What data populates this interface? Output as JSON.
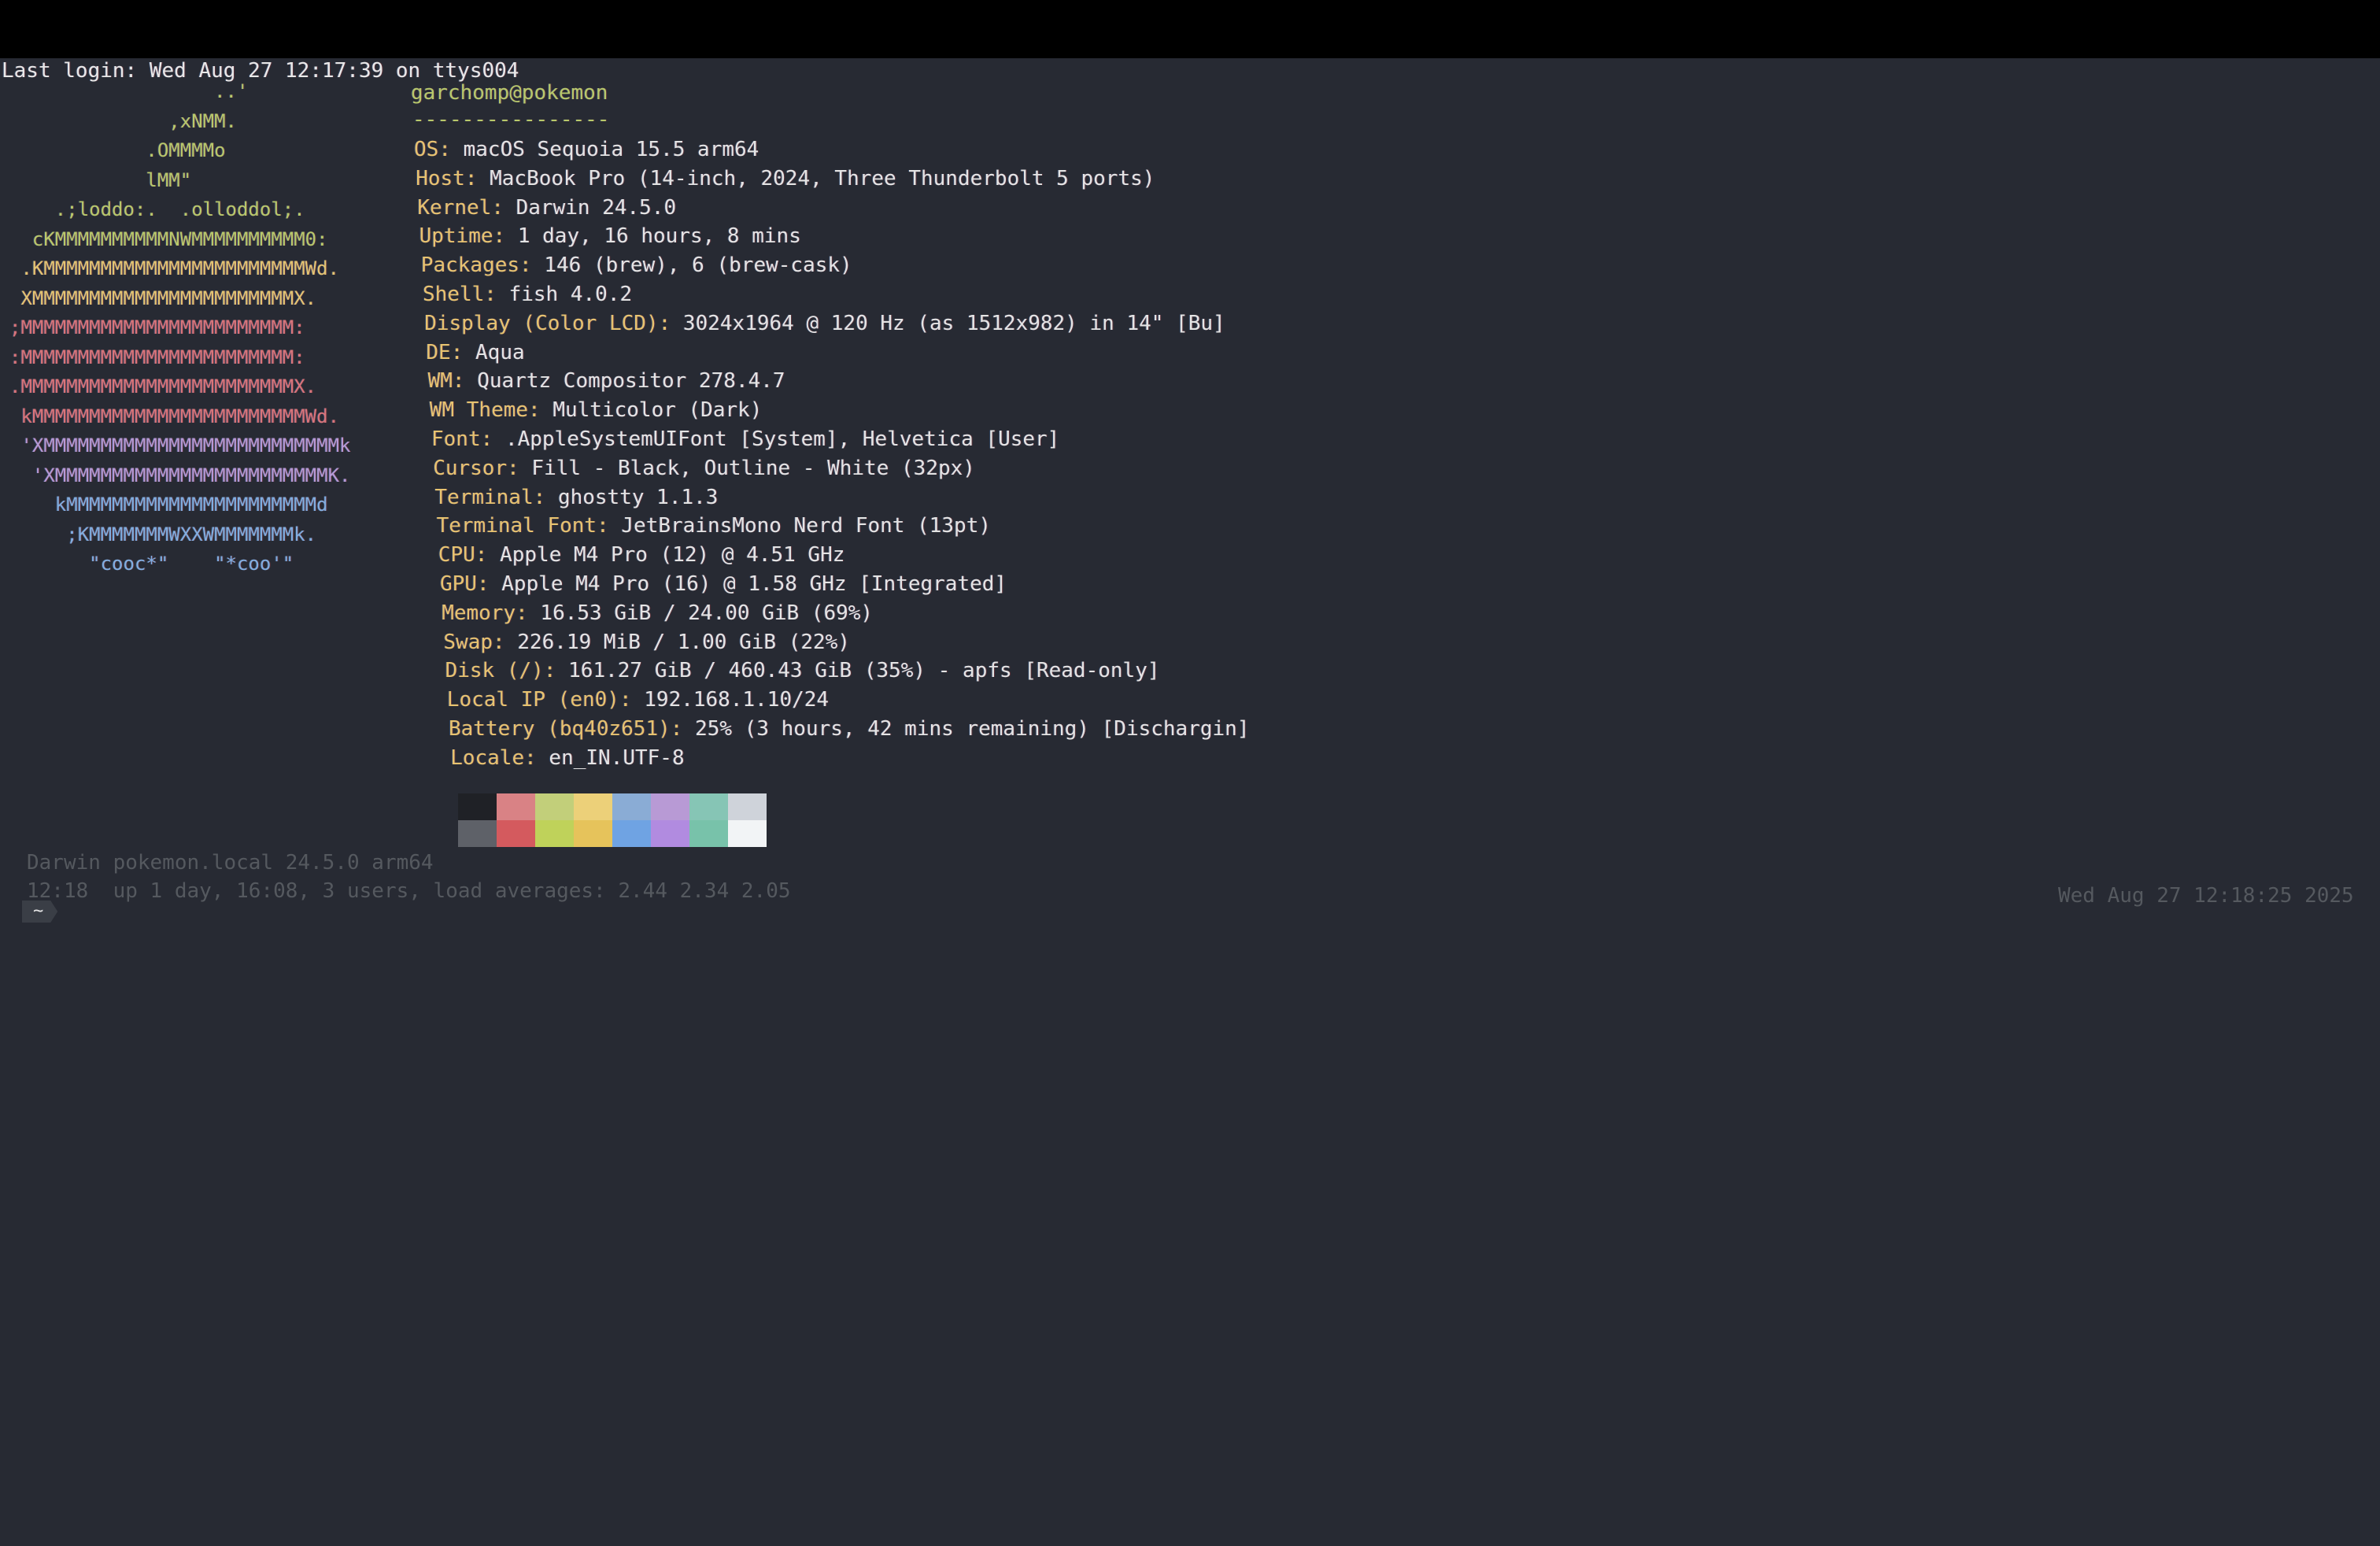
{
  "login_line": "Last login: Wed Aug 27 12:17:39 on ttys004",
  "logo": {
    "rows": [
      {
        "text": "                  ..'",
        "color": "green"
      },
      {
        "text": "              ,xNMM.",
        "color": "green"
      },
      {
        "text": "            .OMMMMo",
        "color": "green"
      },
      {
        "text": "            lMM\"",
        "color": "green"
      },
      {
        "text": "    .;loddo:.  .olloddol;.",
        "color": "green"
      },
      {
        "text": "  cKMMMMMMMMMMNWMMMMMMMMMM0:",
        "color": "green"
      },
      {
        "text": " .KMMMMMMMMMMMMMMMMMMMMMMMWd.",
        "color": "yellow"
      },
      {
        "text": " XMMMMMMMMMMMMMMMMMMMMMMMX.",
        "color": "yellow"
      },
      {
        "text": ";MMMMMMMMMMMMMMMMMMMMMMMM:",
        "color": "red"
      },
      {
        "text": ":MMMMMMMMMMMMMMMMMMMMMMMM:",
        "color": "red"
      },
      {
        "text": ".MMMMMMMMMMMMMMMMMMMMMMMMX.",
        "color": "red"
      },
      {
        "text": " kMMMMMMMMMMMMMMMMMMMMMMMMWd.",
        "color": "red"
      },
      {
        "text": " 'XMMMMMMMMMMMMMMMMMMMMMMMMMMk",
        "color": "purple"
      },
      {
        "text": "  'XMMMMMMMMMMMMMMMMMMMMMMMMK.",
        "color": "purple"
      },
      {
        "text": "    kMMMMMMMMMMMMMMMMMMMMMMd",
        "color": "blue"
      },
      {
        "text": "     ;KMMMMMMMWXXWMMMMMMMk.",
        "color": "blue"
      },
      {
        "text": "       \"cooc*\"    \"*coo'\"",
        "color": "blue"
      }
    ]
  },
  "info": {
    "user_host": "garchomp@pokemon",
    "separator": "----------------",
    "fields": [
      {
        "key": "OS",
        "value": "macOS Sequoia 15.5 arm64"
      },
      {
        "key": "Host",
        "value": "MacBook Pro (14-inch, 2024, Three Thunderbolt 5 ports)"
      },
      {
        "key": "Kernel",
        "value": "Darwin 24.5.0"
      },
      {
        "key": "Uptime",
        "value": "1 day, 16 hours, 8 mins"
      },
      {
        "key": "Packages",
        "value": "146 (brew), 6 (brew-cask)"
      },
      {
        "key": "Shell",
        "value": "fish 4.0.2"
      },
      {
        "key": "Display (Color LCD)",
        "value": "3024x1964 @ 120 Hz (as 1512x982) in 14\" [Bu]"
      },
      {
        "key": "DE",
        "value": "Aqua"
      },
      {
        "key": "WM",
        "value": "Quartz Compositor 278.4.7"
      },
      {
        "key": "WM Theme",
        "value": "Multicolor (Dark)"
      },
      {
        "key": "Font",
        "value": ".AppleSystemUIFont [System], Helvetica [User]"
      },
      {
        "key": "Cursor",
        "value": "Fill - Black, Outline - White (32px)"
      },
      {
        "key": "Terminal",
        "value": "ghostty 1.1.3"
      },
      {
        "key": "Terminal Font",
        "value": "JetBrainsMono Nerd Font (13pt)"
      },
      {
        "key": "CPU",
        "value": "Apple M4 Pro (12) @ 4.51 GHz"
      },
      {
        "key": "GPU",
        "value": "Apple M4 Pro (16) @ 1.58 GHz [Integrated]"
      },
      {
        "key": "Memory",
        "value": "16.53 GiB / 24.00 GiB (69%)"
      },
      {
        "key": "Swap",
        "value": "226.19 MiB / 1.00 GiB (22%)"
      },
      {
        "key": "Disk (/)",
        "value": "161.27 GiB / 460.43 GiB (35%) - apfs [Read-only]"
      },
      {
        "key": "Local IP (en0)",
        "value": "192.168.1.10/24"
      },
      {
        "key": "Battery (bq40z651)",
        "value": "25% (3 hours, 42 mins remaining) [Dischargin]"
      },
      {
        "key": "Locale",
        "value": "en_IN.UTF-8"
      }
    ]
  },
  "palette": {
    "top": [
      "#1f2126",
      "#d98285",
      "#c2cf7a",
      "#ecd079",
      "#8aacd5",
      "#b89ad5",
      "#86c5b5",
      "#cfd3da"
    ],
    "bottom": [
      "#5e6168",
      "#d45a5e",
      "#bfd25a",
      "#e6c35b",
      "#6fa3e3",
      "#b18be0",
      "#78c2aa",
      "#f2f4f6"
    ]
  },
  "footer": {
    "uname": "Darwin pokemon.local 24.5.0 arm64",
    "uptime": "12:18  up 1 day, 16:08, 3 users, load averages: 2.44 2.34 2.05",
    "clock": "Wed Aug 27 12:18:25 2025",
    "prompt": "~"
  }
}
